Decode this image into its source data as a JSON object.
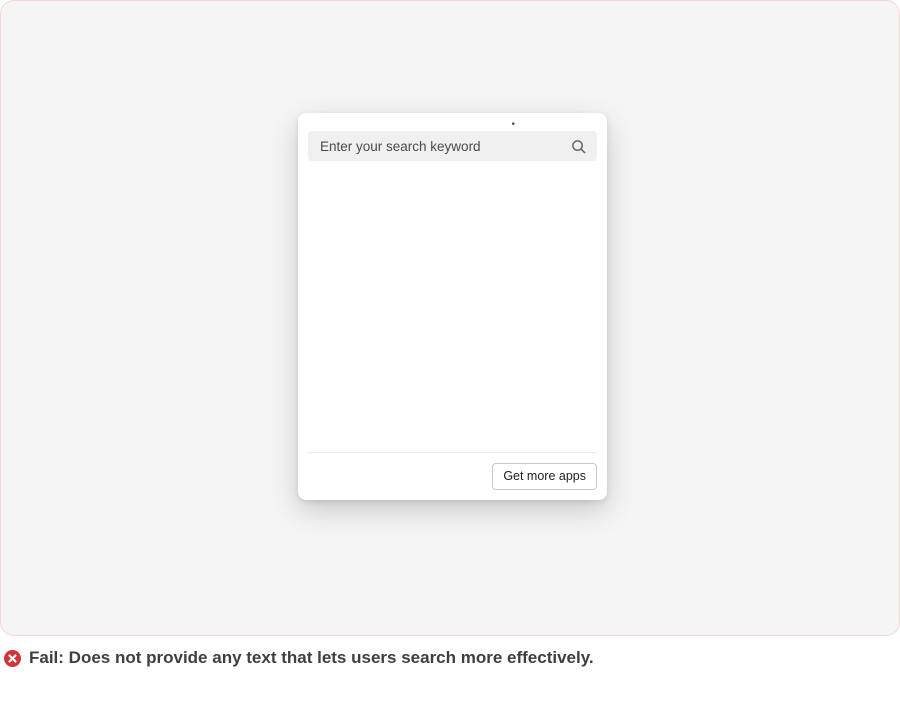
{
  "panel": {
    "search": {
      "placeholder": "Enter your search keyword"
    },
    "footer": {
      "get_more_label": "Get more apps"
    }
  },
  "caption": {
    "status": "fail",
    "text": "Fail: Does not provide any text that lets users search more effectively."
  },
  "colors": {
    "fail_icon_bg": "#d13438",
    "stage_bg": "#f5f5f5",
    "stage_border": "#f3d6d6"
  }
}
